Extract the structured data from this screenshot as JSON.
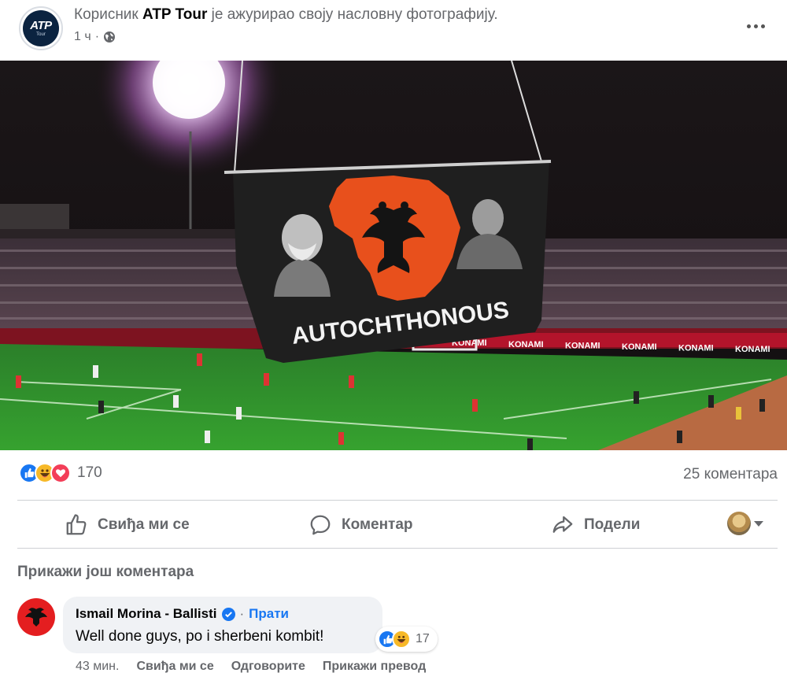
{
  "header": {
    "prefix": "Корисник ",
    "page_name": "ATP Tour",
    "suffix": " је ажурирао своју насловну фотографију.",
    "time": "1 ч",
    "avatar_logo": "ATP",
    "avatar_logo_sub": "Tour",
    "more_icon": "more-horizontal-icon",
    "audience_icon": "globe-icon"
  },
  "photo": {
    "banner_text": "AUTOCHTHONOUS",
    "ad_text": "KONAMI",
    "ad_repeat": 8
  },
  "reactions": {
    "types": [
      "like-reaction-icon",
      "haha-reaction-icon",
      "love-reaction-icon"
    ],
    "count": "170",
    "comments": "25 коментара"
  },
  "actions": {
    "like": "Свиђа ми се",
    "comment": "Коментар",
    "share": "Подели",
    "like_icon": "thumbs-up-icon",
    "comment_icon": "comment-bubble-icon",
    "share_icon": "share-arrow-icon"
  },
  "comments": {
    "more_label": "Прикажи још коментара",
    "items": [
      {
        "author": "Ismail Morina - Ballisti",
        "verified": true,
        "follow": "Прати",
        "separator": "·",
        "text": "Well done guys, po i sherbeni kombit!",
        "reaction_count": "17",
        "time": "43 мин.",
        "like": "Свиђа ми се",
        "reply": "Одговорите",
        "translate": "Прикажи превод"
      }
    ]
  },
  "colors": {
    "brand_blue": "#1877f2",
    "secondary_text": "#65676b",
    "bubble_bg": "#f0f2f5",
    "pitch_green": "#2f8a2c",
    "banner_red": "#e8501c"
  }
}
